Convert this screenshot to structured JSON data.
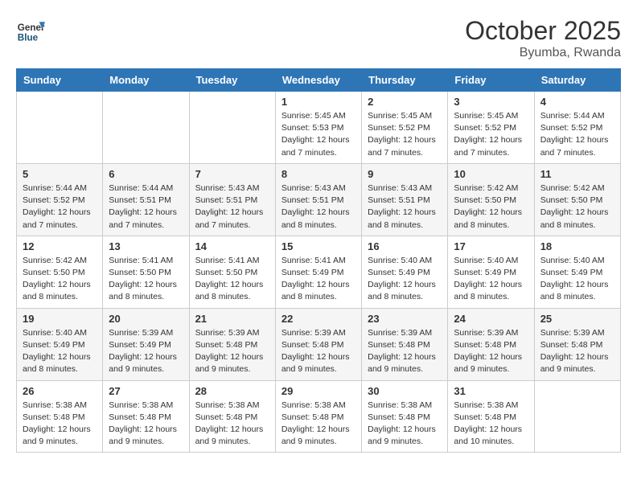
{
  "header": {
    "logo_line1": "General",
    "logo_line2": "Blue",
    "month": "October 2025",
    "location": "Byumba, Rwanda"
  },
  "weekdays": [
    "Sunday",
    "Monday",
    "Tuesday",
    "Wednesday",
    "Thursday",
    "Friday",
    "Saturday"
  ],
  "weeks": [
    [
      {
        "day": "",
        "info": ""
      },
      {
        "day": "",
        "info": ""
      },
      {
        "day": "",
        "info": ""
      },
      {
        "day": "1",
        "info": "Sunrise: 5:45 AM\nSunset: 5:53 PM\nDaylight: 12 hours\nand 7 minutes."
      },
      {
        "day": "2",
        "info": "Sunrise: 5:45 AM\nSunset: 5:52 PM\nDaylight: 12 hours\nand 7 minutes."
      },
      {
        "day": "3",
        "info": "Sunrise: 5:45 AM\nSunset: 5:52 PM\nDaylight: 12 hours\nand 7 minutes."
      },
      {
        "day": "4",
        "info": "Sunrise: 5:44 AM\nSunset: 5:52 PM\nDaylight: 12 hours\nand 7 minutes."
      }
    ],
    [
      {
        "day": "5",
        "info": "Sunrise: 5:44 AM\nSunset: 5:52 PM\nDaylight: 12 hours\nand 7 minutes."
      },
      {
        "day": "6",
        "info": "Sunrise: 5:44 AM\nSunset: 5:51 PM\nDaylight: 12 hours\nand 7 minutes."
      },
      {
        "day": "7",
        "info": "Sunrise: 5:43 AM\nSunset: 5:51 PM\nDaylight: 12 hours\nand 7 minutes."
      },
      {
        "day": "8",
        "info": "Sunrise: 5:43 AM\nSunset: 5:51 PM\nDaylight: 12 hours\nand 8 minutes."
      },
      {
        "day": "9",
        "info": "Sunrise: 5:43 AM\nSunset: 5:51 PM\nDaylight: 12 hours\nand 8 minutes."
      },
      {
        "day": "10",
        "info": "Sunrise: 5:42 AM\nSunset: 5:50 PM\nDaylight: 12 hours\nand 8 minutes."
      },
      {
        "day": "11",
        "info": "Sunrise: 5:42 AM\nSunset: 5:50 PM\nDaylight: 12 hours\nand 8 minutes."
      }
    ],
    [
      {
        "day": "12",
        "info": "Sunrise: 5:42 AM\nSunset: 5:50 PM\nDaylight: 12 hours\nand 8 minutes."
      },
      {
        "day": "13",
        "info": "Sunrise: 5:41 AM\nSunset: 5:50 PM\nDaylight: 12 hours\nand 8 minutes."
      },
      {
        "day": "14",
        "info": "Sunrise: 5:41 AM\nSunset: 5:50 PM\nDaylight: 12 hours\nand 8 minutes."
      },
      {
        "day": "15",
        "info": "Sunrise: 5:41 AM\nSunset: 5:49 PM\nDaylight: 12 hours\nand 8 minutes."
      },
      {
        "day": "16",
        "info": "Sunrise: 5:40 AM\nSunset: 5:49 PM\nDaylight: 12 hours\nand 8 minutes."
      },
      {
        "day": "17",
        "info": "Sunrise: 5:40 AM\nSunset: 5:49 PM\nDaylight: 12 hours\nand 8 minutes."
      },
      {
        "day": "18",
        "info": "Sunrise: 5:40 AM\nSunset: 5:49 PM\nDaylight: 12 hours\nand 8 minutes."
      }
    ],
    [
      {
        "day": "19",
        "info": "Sunrise: 5:40 AM\nSunset: 5:49 PM\nDaylight: 12 hours\nand 8 minutes."
      },
      {
        "day": "20",
        "info": "Sunrise: 5:39 AM\nSunset: 5:49 PM\nDaylight: 12 hours\nand 9 minutes."
      },
      {
        "day": "21",
        "info": "Sunrise: 5:39 AM\nSunset: 5:48 PM\nDaylight: 12 hours\nand 9 minutes."
      },
      {
        "day": "22",
        "info": "Sunrise: 5:39 AM\nSunset: 5:48 PM\nDaylight: 12 hours\nand 9 minutes."
      },
      {
        "day": "23",
        "info": "Sunrise: 5:39 AM\nSunset: 5:48 PM\nDaylight: 12 hours\nand 9 minutes."
      },
      {
        "day": "24",
        "info": "Sunrise: 5:39 AM\nSunset: 5:48 PM\nDaylight: 12 hours\nand 9 minutes."
      },
      {
        "day": "25",
        "info": "Sunrise: 5:39 AM\nSunset: 5:48 PM\nDaylight: 12 hours\nand 9 minutes."
      }
    ],
    [
      {
        "day": "26",
        "info": "Sunrise: 5:38 AM\nSunset: 5:48 PM\nDaylight: 12 hours\nand 9 minutes."
      },
      {
        "day": "27",
        "info": "Sunrise: 5:38 AM\nSunset: 5:48 PM\nDaylight: 12 hours\nand 9 minutes."
      },
      {
        "day": "28",
        "info": "Sunrise: 5:38 AM\nSunset: 5:48 PM\nDaylight: 12 hours\nand 9 minutes."
      },
      {
        "day": "29",
        "info": "Sunrise: 5:38 AM\nSunset: 5:48 PM\nDaylight: 12 hours\nand 9 minutes."
      },
      {
        "day": "30",
        "info": "Sunrise: 5:38 AM\nSunset: 5:48 PM\nDaylight: 12 hours\nand 9 minutes."
      },
      {
        "day": "31",
        "info": "Sunrise: 5:38 AM\nSunset: 5:48 PM\nDaylight: 12 hours\nand 10 minutes."
      },
      {
        "day": "",
        "info": ""
      }
    ]
  ]
}
